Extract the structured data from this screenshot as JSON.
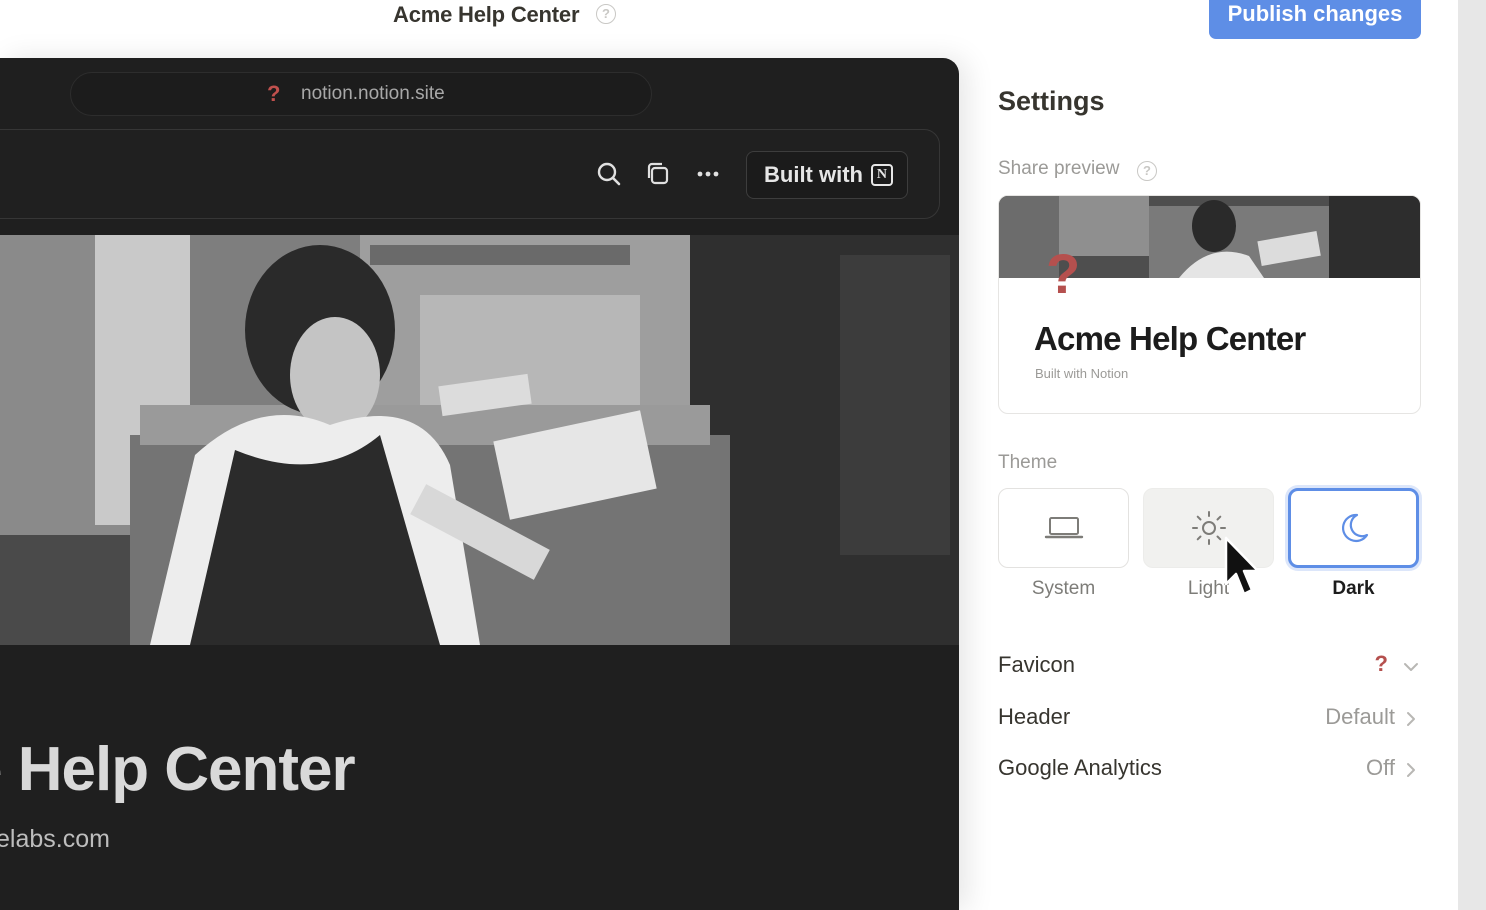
{
  "topbar": {
    "title": "Acme Help Center",
    "publish_label": "Publish changes"
  },
  "preview": {
    "url": "notion.notion.site",
    "built_with_label": "Built with",
    "hero_title": "e Help Center",
    "hero_domain": "elabs.com"
  },
  "settings": {
    "title": "Settings",
    "share_preview_label": "Share preview",
    "share_card": {
      "icon": "?",
      "title": "Acme Help Center",
      "subtitle": "Built with Notion"
    },
    "theme_label": "Theme",
    "themes": [
      {
        "label": "System",
        "icon": "laptop-icon"
      },
      {
        "label": "Light",
        "icon": "sun-icon"
      },
      {
        "label": "Dark",
        "icon": "moon-icon",
        "selected": true
      }
    ],
    "rows": [
      {
        "label": "Favicon",
        "value": "?",
        "chevron": "chevron-down-icon"
      },
      {
        "label": "Header",
        "value": "Default",
        "chevron": "chevron-right-icon"
      },
      {
        "label": "Google Analytics",
        "value": "Off",
        "chevron": "chevron-right-icon"
      }
    ]
  },
  "colors": {
    "accent": "#5e8ee6",
    "favicon_red": "#b5504e",
    "preview_bg": "#1f1f1f"
  }
}
